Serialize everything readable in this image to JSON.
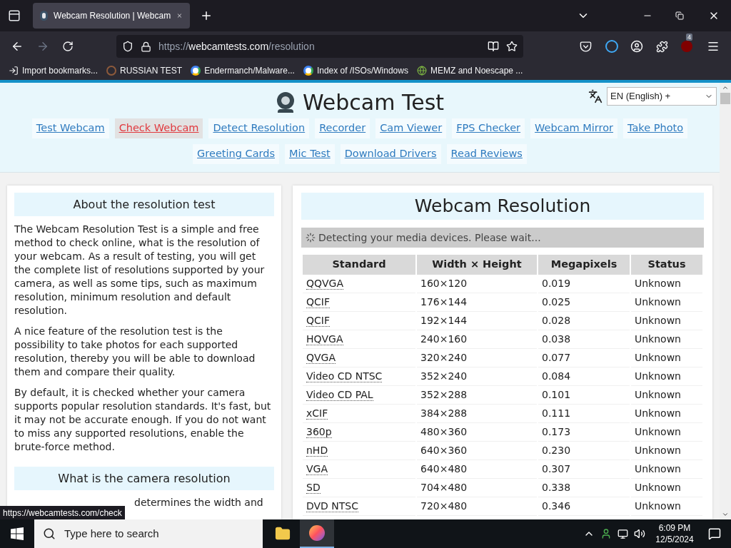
{
  "browser": {
    "tab": {
      "title": "Webcam Resolution | Webcam",
      "selected": true
    },
    "url": {
      "prefix": "https://",
      "domain": "webcamtests.com",
      "path": "/resolution"
    },
    "extension_badge": "4",
    "bookmarks": [
      {
        "label": "Import bookmarks...",
        "kind": "import"
      },
      {
        "label": "RUSSIAN TEST",
        "kind": "site"
      },
      {
        "label": "Endermanch/Malware...",
        "kind": "google"
      },
      {
        "label": "Index of /ISOs/Windows",
        "kind": "google"
      },
      {
        "label": "MEMZ and Noescape ...",
        "kind": "globe"
      }
    ]
  },
  "page": {
    "site_title": "Webcam Test",
    "language": "EN (English) +",
    "nav": [
      {
        "label": "Test Webcam",
        "hovered": false
      },
      {
        "label": "Check Webcam",
        "hovered": true
      },
      {
        "label": "Detect Resolution",
        "hovered": false
      },
      {
        "label": "Recorder",
        "hovered": false
      },
      {
        "label": "Cam Viewer",
        "hovered": false
      },
      {
        "label": "FPS Checker",
        "hovered": false
      },
      {
        "label": "Webcam Mirror",
        "hovered": false
      },
      {
        "label": "Take Photo",
        "hovered": false
      },
      {
        "label": "Greeting Cards",
        "hovered": false
      },
      {
        "label": "Mic Test",
        "hovered": false
      },
      {
        "label": "Download Drivers",
        "hovered": false
      },
      {
        "label": "Read Reviews",
        "hovered": false
      }
    ],
    "about": {
      "heading": "About the resolution test",
      "paragraphs": [
        "The Webcam Resolution Test is a simple and free method to check online, what is the resolution of your webcam. As a result of testing, you will get the complete list of resolutions supported by your camera, as well as some tips, such as maximum resolution, minimum resolution and default resolution.",
        "A nice feature of the resolution test is the possibility to take photos for each supported resolution, thereby you will be able to download them and compare their quality.",
        "By default, it is checked whether your camera supports popular resolution standards. It's fast, but it may not be accurate enough. If you do not want to miss any supported resolutions, enable the brute-force method."
      ],
      "heading_2": "What is the camera resolution",
      "partial_text": "determines the width and"
    },
    "results": {
      "heading": "Webcam Resolution",
      "status_message": "Detecting your media devices. Please wait...",
      "table": {
        "columns": [
          "Standard",
          "Width × Height",
          "Megapixels",
          "Status"
        ],
        "rows": [
          [
            "QQVGA",
            "160×120",
            "0.019",
            "Unknown"
          ],
          [
            "QCIF",
            "176×144",
            "0.025",
            "Unknown"
          ],
          [
            "QCIF",
            "192×144",
            "0.028",
            "Unknown"
          ],
          [
            "HQVGA",
            "240×160",
            "0.038",
            "Unknown"
          ],
          [
            "QVGA",
            "320×240",
            "0.077",
            "Unknown"
          ],
          [
            "Video CD NTSC",
            "352×240",
            "0.084",
            "Unknown"
          ],
          [
            "Video CD PAL",
            "352×288",
            "0.101",
            "Unknown"
          ],
          [
            "xCIF",
            "384×288",
            "0.111",
            "Unknown"
          ],
          [
            "360p",
            "480×360",
            "0.173",
            "Unknown"
          ],
          [
            "nHD",
            "640×360",
            "0.230",
            "Unknown"
          ],
          [
            "VGA",
            "640×480",
            "0.307",
            "Unknown"
          ],
          [
            "SD",
            "704×480",
            "0.338",
            "Unknown"
          ],
          [
            "DVD NTSC",
            "720×480",
            "0.346",
            "Unknown"
          ]
        ]
      }
    }
  },
  "status_link": "https://webcamtests.com/check",
  "taskbar": {
    "search_placeholder": "Type here to search",
    "time": "6:09 PM",
    "date": "12/5/2024"
  }
}
